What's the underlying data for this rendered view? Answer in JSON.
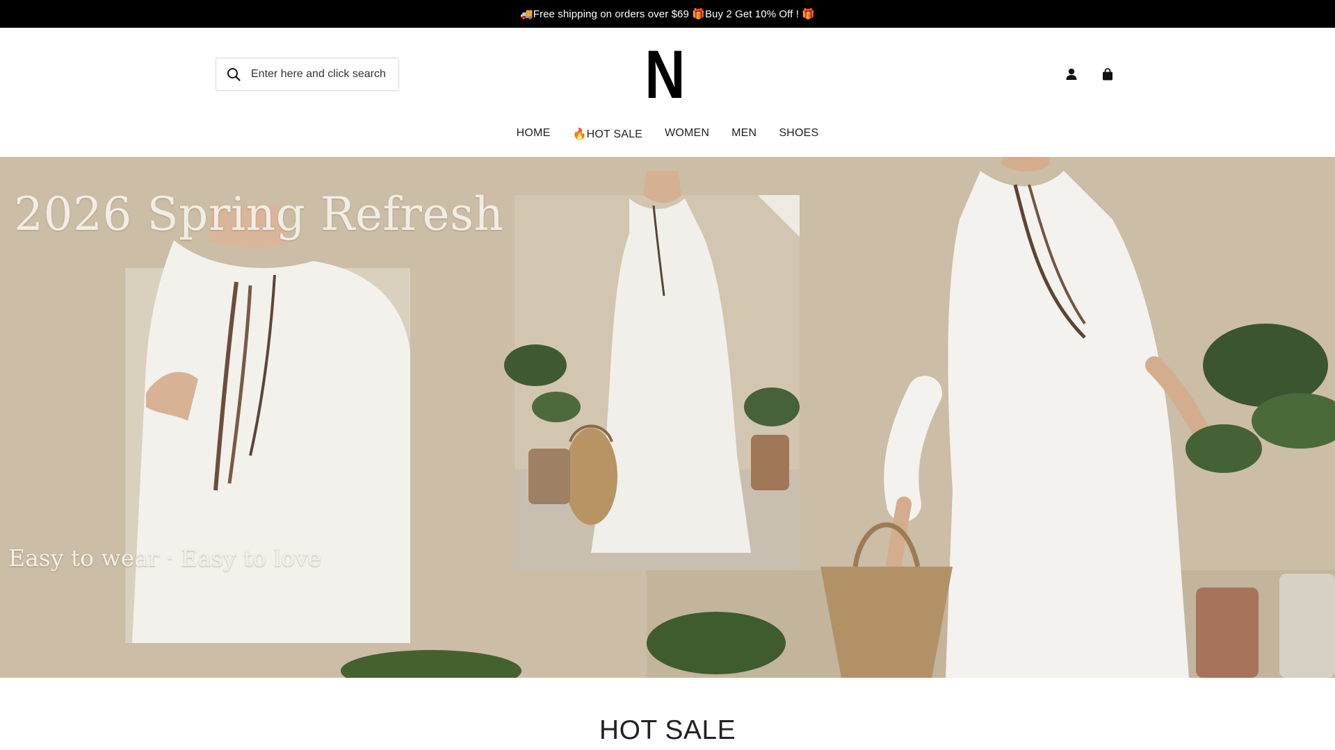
{
  "announcement": {
    "text": "🚚Free shipping on orders over $69 🎁Buy 2 Get 10% Off ! 🎁"
  },
  "header": {
    "search": {
      "placeholder": "Enter here and click search",
      "value": ""
    },
    "logo_letter": "N",
    "icons": [
      "search-icon",
      "account-icon",
      "cart-icon"
    ]
  },
  "nav": {
    "items": [
      {
        "label": "HOME"
      },
      {
        "label": "🔥HOT SALE"
      },
      {
        "label": "WOMEN"
      },
      {
        "label": "MEN"
      },
      {
        "label": "SHOES"
      }
    ]
  },
  "hero": {
    "title": "2026 Spring Refresh",
    "subtitle": "Easy to wear · Easy to love"
  },
  "sections": {
    "hot_sale_title": "HOT SALE"
  },
  "colors": {
    "announcement_bg": "#000000",
    "announcement_text": "#ffffff",
    "hero_background": "#cbbda6",
    "text": "#222222"
  }
}
